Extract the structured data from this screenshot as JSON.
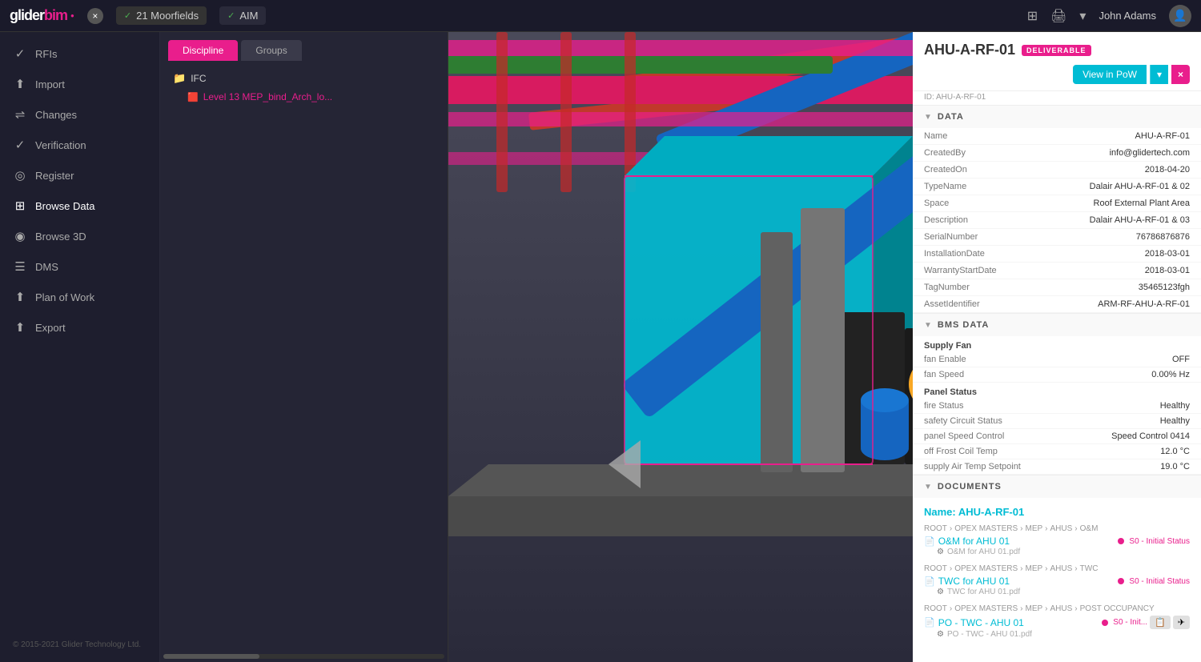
{
  "app": {
    "logo": "gliderbim",
    "logo_accent": "bim"
  },
  "topbar": {
    "tabs": [
      {
        "label": "21 Moorfields",
        "active": true
      },
      {
        "label": "AIM",
        "active": false
      }
    ],
    "icons": [
      "grid-icon",
      "print-icon",
      "chevron-down-icon"
    ],
    "user": "John Adams",
    "close_label": "×"
  },
  "sidebar": {
    "items": [
      {
        "id": "rfis",
        "icon": "✓",
        "label": "RFIs"
      },
      {
        "id": "import",
        "icon": "↑",
        "label": "Import"
      },
      {
        "id": "changes",
        "icon": "~",
        "label": "Changes"
      },
      {
        "id": "verification",
        "icon": "✓",
        "label": "Verification"
      },
      {
        "id": "register",
        "icon": "◎",
        "label": "Register"
      },
      {
        "id": "browse-data",
        "icon": "⊞",
        "label": "Browse Data"
      },
      {
        "id": "browse-3d",
        "icon": "◉",
        "label": "Browse 3D"
      },
      {
        "id": "dms",
        "icon": "☰",
        "label": "DMS"
      },
      {
        "id": "plan-of-work",
        "icon": "↑",
        "label": "Plan of Work"
      },
      {
        "id": "export",
        "icon": "↑",
        "label": "Export"
      }
    ],
    "footer": "© 2015-2021 Glider Technology Ltd."
  },
  "left_panel": {
    "tabs": [
      {
        "label": "Discipline",
        "active": true
      },
      {
        "label": "Groups",
        "active": false
      }
    ],
    "tree": {
      "folder": "IFC",
      "file": "Level 13 MEP_bind_Arch_lo..."
    }
  },
  "right_panel": {
    "title": "AHU-A-RF-01",
    "badge": "DELIVERABLE",
    "id_label": "ID: AHU-A-RF-01",
    "btn_view": "View in PoW",
    "btn_x": "×",
    "data_section": {
      "label": "DATA",
      "rows": [
        {
          "key": "Name",
          "value": "AHU-A-RF-01"
        },
        {
          "key": "CreatedBy",
          "value": "info@glidertech.com"
        },
        {
          "key": "CreatedOn",
          "value": "2018-04-20"
        },
        {
          "key": "TypeName",
          "value": "Dalair AHU-A-RF-01 & 02"
        },
        {
          "key": "Space",
          "value": "Roof External Plant Area"
        },
        {
          "key": "Description",
          "value": "Dalair AHU-A-RF-01 & 03"
        },
        {
          "key": "SerialNumber",
          "value": "76786876876"
        },
        {
          "key": "InstallationDate",
          "value": "2018-03-01"
        },
        {
          "key": "WarrantyStartDate",
          "value": "2018-03-01"
        },
        {
          "key": "TagNumber",
          "value": "35465123fgh"
        },
        {
          "key": "AssetIdentifier",
          "value": "ARM-RF-AHU-A-RF-01"
        }
      ]
    },
    "bms_section": {
      "label": "BMS DATA",
      "supply_fan_label": "Supply Fan",
      "rows_supply": [
        {
          "key": "fan Enable",
          "value": "OFF"
        },
        {
          "key": "fan Speed",
          "value": "0.00% Hz"
        }
      ],
      "panel_status_label": "Panel Status",
      "rows_panel": [
        {
          "key": "fire Status",
          "value": "Healthy"
        },
        {
          "key": "safety Circuit Status",
          "value": "Healthy"
        },
        {
          "key": "panel Speed Control",
          "value": "Speed Control 0414"
        },
        {
          "key": "off Frost Coil Temp",
          "value": "12.0 °C"
        },
        {
          "key": "supply Air Temp Setpoint",
          "value": "19.0 °C"
        }
      ]
    },
    "documents_section": {
      "label": "DOCUMENTS",
      "name_header": "Name: AHU-A-RF-01",
      "documents": [
        {
          "breadcrumb": [
            "ROOT",
            ">",
            "OPEX MASTERS",
            ">",
            "MEP",
            ">",
            "AHUS",
            ">",
            "O&M"
          ],
          "link": "O&M for AHU 01",
          "status": "S0 - Initial Status",
          "sub": "O&M for AHU 01.pdf"
        },
        {
          "breadcrumb": [
            "ROOT",
            ">",
            "OPEX MASTERS",
            ">",
            "MEP",
            ">",
            "AHUS",
            ">",
            "TWC"
          ],
          "link": "TWC for AHU 01",
          "status": "S0 - Initial Status",
          "sub": "TWC for AHU 01.pdf"
        },
        {
          "breadcrumb": [
            "ROOT",
            ">",
            "OPEX MASTERS",
            ">",
            "MEP",
            ">",
            "AHUS",
            ">",
            "POST OCCUPANCY"
          ],
          "link": "PO - TWC - AHU 01",
          "status": "S0 - Init...",
          "sub": "PO - TWC - AHU 01.pdf"
        }
      ]
    }
  }
}
